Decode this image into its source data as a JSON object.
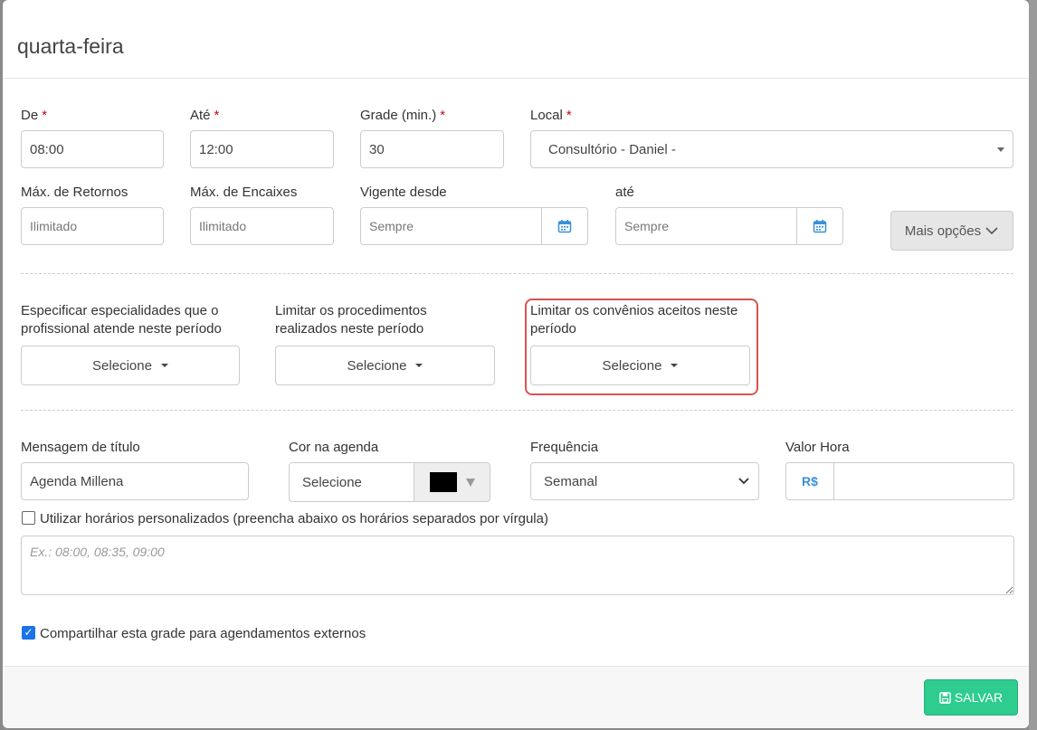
{
  "modal": {
    "title": "quarta-feira"
  },
  "row1": {
    "de": {
      "label": "De",
      "value": "08:00"
    },
    "ate": {
      "label": "Até",
      "value": "12:00"
    },
    "grade": {
      "label": "Grade (min.)",
      "value": "30"
    },
    "local": {
      "label": "Local",
      "value": "Consultório - Daniel -"
    }
  },
  "row2": {
    "max_retornos": {
      "label": "Máx. de Retornos",
      "placeholder": "Ilimitado"
    },
    "max_encaixes": {
      "label": "Máx. de Encaixes",
      "placeholder": "Ilimitado"
    },
    "vigente_desde": {
      "label": "Vigente desde",
      "placeholder": "Sempre"
    },
    "ate": {
      "label": "até",
      "placeholder": "Sempre"
    },
    "mais_opcoes": "Mais opções"
  },
  "limits": {
    "especialidades": {
      "label": "Especificar especialidades que o profissional atende neste período",
      "button": "Selecione"
    },
    "procedimentos": {
      "label": "Limitar os procedimentos realizados neste período",
      "button": "Selecione"
    },
    "convenios": {
      "label": "Limitar os convênios aceitos neste período",
      "button": "Selecione"
    }
  },
  "row3": {
    "mensagem": {
      "label": "Mensagem de título",
      "value": "Agenda Millena"
    },
    "cor": {
      "label": "Cor na agenda",
      "value": "Selecione",
      "swatch_color": "#000000"
    },
    "frequencia": {
      "label": "Frequência",
      "value": "Semanal"
    },
    "valor_hora": {
      "label": "Valor Hora",
      "currency": "R$",
      "value": ""
    }
  },
  "personalizados": {
    "label": "Utilizar horários personalizados (preencha abaixo os horários separados por vírgula)",
    "checked": false,
    "placeholder": "Ex.: 08:00, 08:35, 09:00"
  },
  "compartilhar": {
    "label": "Compartilhar esta grade para agendamentos externos",
    "checked": true
  },
  "footer": {
    "save_label": "SALVAR"
  },
  "colors": {
    "accent_blue": "#3a8fd9",
    "save_green": "#2ecc8f",
    "required_red": "#d0021b",
    "highlight_red": "#d9534f"
  }
}
